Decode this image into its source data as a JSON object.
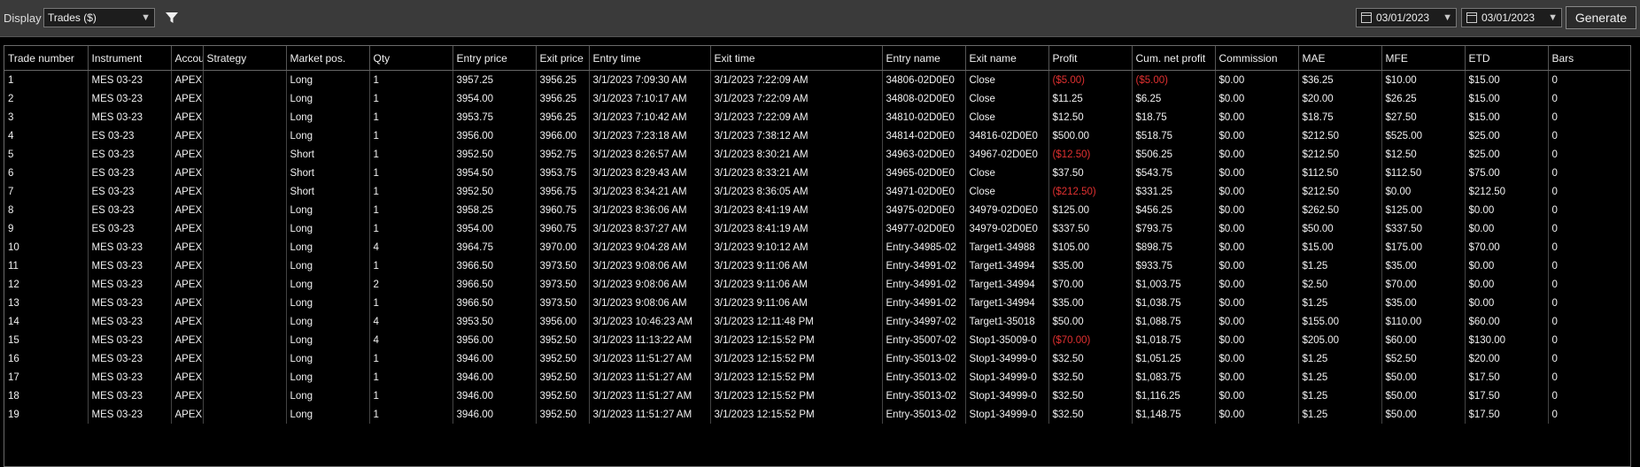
{
  "toolbar": {
    "display_label": "Display",
    "display_value": "Trades ($)",
    "start_date": "03/01/2023",
    "end_date": "03/01/2023",
    "generate_label": "Generate"
  },
  "columns": [
    "Trade number",
    "Instrument",
    "Account",
    "Strategy",
    "Market pos.",
    "Qty",
    "Entry price",
    "Exit price",
    "Entry time",
    "Exit time",
    "Entry name",
    "Exit name",
    "Profit",
    "Cum. net profit",
    "Commission",
    "MAE",
    "MFE",
    "ETD",
    "Bars"
  ],
  "rows": [
    [
      "1",
      "MES 03-23",
      "APEX",
      "",
      "Long",
      "1",
      "3957.25",
      "3956.25",
      "3/1/2023 7:09:30 AM",
      "3/1/2023 7:22:09 AM",
      "34806-02D0E0",
      "Close",
      "($5.00)",
      "($5.00)",
      "$0.00",
      "$36.25",
      "$10.00",
      "$15.00",
      "0"
    ],
    [
      "2",
      "MES 03-23",
      "APEX",
      "",
      "Long",
      "1",
      "3954.00",
      "3956.25",
      "3/1/2023 7:10:17 AM",
      "3/1/2023 7:22:09 AM",
      "34808-02D0E0",
      "Close",
      "$11.25",
      "$6.25",
      "$0.00",
      "$20.00",
      "$26.25",
      "$15.00",
      "0"
    ],
    [
      "3",
      "MES 03-23",
      "APEX",
      "",
      "Long",
      "1",
      "3953.75",
      "3956.25",
      "3/1/2023 7:10:42 AM",
      "3/1/2023 7:22:09 AM",
      "34810-02D0E0",
      "Close",
      "$12.50",
      "$18.75",
      "$0.00",
      "$18.75",
      "$27.50",
      "$15.00",
      "0"
    ],
    [
      "4",
      "ES 03-23",
      "APEX",
      "",
      "Long",
      "1",
      "3956.00",
      "3966.00",
      "3/1/2023 7:23:18 AM",
      "3/1/2023 7:38:12 AM",
      "34814-02D0E0",
      "34816-02D0E0",
      "$500.00",
      "$518.75",
      "$0.00",
      "$212.50",
      "$525.00",
      "$25.00",
      "0"
    ],
    [
      "5",
      "ES 03-23",
      "APEX",
      "",
      "Short",
      "1",
      "3952.50",
      "3952.75",
      "3/1/2023 8:26:57 AM",
      "3/1/2023 8:30:21 AM",
      "34963-02D0E0",
      "34967-02D0E0",
      "($12.50)",
      "$506.25",
      "$0.00",
      "$212.50",
      "$12.50",
      "$25.00",
      "0"
    ],
    [
      "6",
      "ES 03-23",
      "APEX",
      "",
      "Short",
      "1",
      "3954.50",
      "3953.75",
      "3/1/2023 8:29:43 AM",
      "3/1/2023 8:33:21 AM",
      "34965-02D0E0",
      "Close",
      "$37.50",
      "$543.75",
      "$0.00",
      "$112.50",
      "$112.50",
      "$75.00",
      "0"
    ],
    [
      "7",
      "ES 03-23",
      "APEX",
      "",
      "Short",
      "1",
      "3952.50",
      "3956.75",
      "3/1/2023 8:34:21 AM",
      "3/1/2023 8:36:05 AM",
      "34971-02D0E0",
      "Close",
      "($212.50)",
      "$331.25",
      "$0.00",
      "$212.50",
      "$0.00",
      "$212.50",
      "0"
    ],
    [
      "8",
      "ES 03-23",
      "APEX",
      "",
      "Long",
      "1",
      "3958.25",
      "3960.75",
      "3/1/2023 8:36:06 AM",
      "3/1/2023 8:41:19 AM",
      "34975-02D0E0",
      "34979-02D0E0",
      "$125.00",
      "$456.25",
      "$0.00",
      "$262.50",
      "$125.00",
      "$0.00",
      "0"
    ],
    [
      "9",
      "ES 03-23",
      "APEX",
      "",
      "Long",
      "1",
      "3954.00",
      "3960.75",
      "3/1/2023 8:37:27 AM",
      "3/1/2023 8:41:19 AM",
      "34977-02D0E0",
      "34979-02D0E0",
      "$337.50",
      "$793.75",
      "$0.00",
      "$50.00",
      "$337.50",
      "$0.00",
      "0"
    ],
    [
      "10",
      "MES 03-23",
      "APEX",
      "",
      "Long",
      "4",
      "3964.75",
      "3970.00",
      "3/1/2023 9:04:28 AM",
      "3/1/2023 9:10:12 AM",
      "Entry-34985-02",
      "Target1-34988",
      "$105.00",
      "$898.75",
      "$0.00",
      "$15.00",
      "$175.00",
      "$70.00",
      "0"
    ],
    [
      "11",
      "MES 03-23",
      "APEX",
      "",
      "Long",
      "1",
      "3966.50",
      "3973.50",
      "3/1/2023 9:08:06 AM",
      "3/1/2023 9:11:06 AM",
      "Entry-34991-02",
      "Target1-34994",
      "$35.00",
      "$933.75",
      "$0.00",
      "$1.25",
      "$35.00",
      "$0.00",
      "0"
    ],
    [
      "12",
      "MES 03-23",
      "APEX",
      "",
      "Long",
      "2",
      "3966.50",
      "3973.50",
      "3/1/2023 9:08:06 AM",
      "3/1/2023 9:11:06 AM",
      "Entry-34991-02",
      "Target1-34994",
      "$70.00",
      "$1,003.75",
      "$0.00",
      "$2.50",
      "$70.00",
      "$0.00",
      "0"
    ],
    [
      "13",
      "MES 03-23",
      "APEX",
      "",
      "Long",
      "1",
      "3966.50",
      "3973.50",
      "3/1/2023 9:08:06 AM",
      "3/1/2023 9:11:06 AM",
      "Entry-34991-02",
      "Target1-34994",
      "$35.00",
      "$1,038.75",
      "$0.00",
      "$1.25",
      "$35.00",
      "$0.00",
      "0"
    ],
    [
      "14",
      "MES 03-23",
      "APEX",
      "",
      "Long",
      "4",
      "3953.50",
      "3956.00",
      "3/1/2023 10:46:23 AM",
      "3/1/2023 12:11:48 PM",
      "Entry-34997-02",
      "Target1-35018",
      "$50.00",
      "$1,088.75",
      "$0.00",
      "$155.00",
      "$110.00",
      "$60.00",
      "0"
    ],
    [
      "15",
      "MES 03-23",
      "APEX",
      "",
      "Long",
      "4",
      "3956.00",
      "3952.50",
      "3/1/2023 11:13:22 AM",
      "3/1/2023 12:15:52 PM",
      "Entry-35007-02",
      "Stop1-35009-0",
      "($70.00)",
      "$1,018.75",
      "$0.00",
      "$205.00",
      "$60.00",
      "$130.00",
      "0"
    ],
    [
      "16",
      "MES 03-23",
      "APEX",
      "",
      "Long",
      "1",
      "3946.00",
      "3952.50",
      "3/1/2023 11:51:27 AM",
      "3/1/2023 12:15:52 PM",
      "Entry-35013-02",
      "Stop1-34999-0",
      "$32.50",
      "$1,051.25",
      "$0.00",
      "$1.25",
      "$52.50",
      "$20.00",
      "0"
    ],
    [
      "17",
      "MES 03-23",
      "APEX",
      "",
      "Long",
      "1",
      "3946.00",
      "3952.50",
      "3/1/2023 11:51:27 AM",
      "3/1/2023 12:15:52 PM",
      "Entry-35013-02",
      "Stop1-34999-0",
      "$32.50",
      "$1,083.75",
      "$0.00",
      "$1.25",
      "$50.00",
      "$17.50",
      "0"
    ],
    [
      "18",
      "MES 03-23",
      "APEX",
      "",
      "Long",
      "1",
      "3946.00",
      "3952.50",
      "3/1/2023 11:51:27 AM",
      "3/1/2023 12:15:52 PM",
      "Entry-35013-02",
      "Stop1-34999-0",
      "$32.50",
      "$1,116.25",
      "$0.00",
      "$1.25",
      "$50.00",
      "$17.50",
      "0"
    ],
    [
      "19",
      "MES 03-23",
      "APEX",
      "",
      "Long",
      "1",
      "3946.00",
      "3952.50",
      "3/1/2023 11:51:27 AM",
      "3/1/2023 12:15:52 PM",
      "Entry-35013-02",
      "Stop1-34999-0",
      "$32.50",
      "$1,148.75",
      "$0.00",
      "$1.25",
      "$50.00",
      "$17.50",
      "0"
    ]
  ],
  "colors": {
    "negative": "#e03030",
    "toolbar": "#3a3a3a",
    "background": "#000000"
  }
}
